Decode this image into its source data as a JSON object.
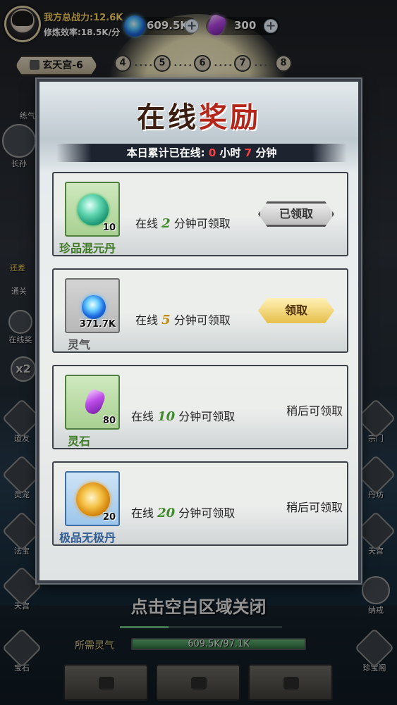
{
  "top": {
    "combat_power": "我方总战力:12.6K",
    "cultivation_rate": "修炼效率:18.5K/分",
    "lingqi_value": "609.5K",
    "stone_value": "300"
  },
  "stage": {
    "name": "玄天宫-6",
    "nodes": [
      "4",
      "5",
      "6",
      "7",
      "8"
    ]
  },
  "side_left": [
    {
      "label": "练气"
    },
    {
      "label": "长孙"
    },
    {
      "label": "还差"
    },
    {
      "label": "通关"
    },
    {
      "label": "在线奖"
    },
    {
      "label": "x2"
    },
    {
      "label": "道友"
    },
    {
      "label": "灵宠"
    },
    {
      "label": "法宝"
    },
    {
      "label": "天宫"
    },
    {
      "label": "宝石"
    }
  ],
  "side_right": [
    {
      "label": "宗门"
    },
    {
      "label": "丹坊"
    },
    {
      "label": "天宫"
    },
    {
      "label": "纳戒"
    },
    {
      "label": "珍宝阁"
    }
  ],
  "modal": {
    "title_a": "在线",
    "title_b": "奖励",
    "online_prefix": "本日累计已在线: ",
    "online_hours": "0",
    "hours_unit": " 小时 ",
    "online_minutes": "7",
    "minutes_unit": " 分钟",
    "rewards": [
      {
        "item_name": "珍品混元丹",
        "count": "10",
        "req_prefix": "在线 ",
        "minutes": "2",
        "req_suffix": " 分钟可领取",
        "action": "已领取"
      },
      {
        "item_name": "灵气",
        "count": "371.7K",
        "req_prefix": "在线 ",
        "minutes": "5",
        "req_suffix": " 分钟可领取",
        "action": "领取"
      },
      {
        "item_name": "灵石",
        "count": "80",
        "req_prefix": "在线 ",
        "minutes": "10",
        "req_suffix": " 分钟可领取",
        "action": "稍后可领取"
      },
      {
        "item_name": "极品无极丹",
        "count": "20",
        "req_prefix": "在线 ",
        "minutes": "20",
        "req_suffix": " 分钟可领取",
        "action": "稍后可领取"
      }
    ]
  },
  "close_hint": "点击空白区域关闭",
  "requirement": {
    "label": "所需灵气",
    "value_text": "609.5K/97.1K",
    "fill_ratio": 1.0
  },
  "colors": {
    "accent_gold": "#f7d35c",
    "highlight_red": "#ff4040",
    "green_item": "#3e7a25",
    "blue_item": "#2f5c93"
  }
}
